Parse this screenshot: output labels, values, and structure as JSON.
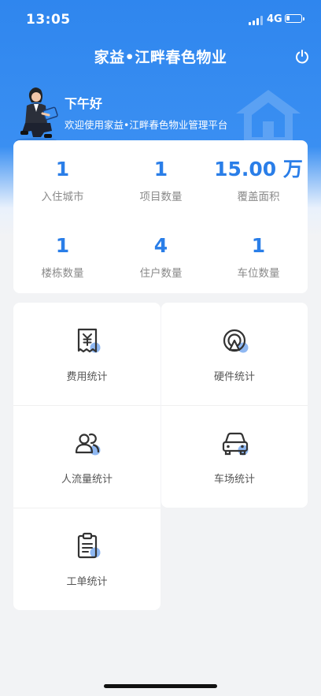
{
  "status_bar": {
    "time": "13:05",
    "network": "4G"
  },
  "nav": {
    "title": "家益•江畔春色物业",
    "power_icon": "power-icon"
  },
  "greeting": {
    "title": "下午好",
    "subtitle": "欢迎使用家益•江畔春色物业管理平台"
  },
  "stats": [
    {
      "value": "1",
      "label": "入住城市"
    },
    {
      "value": "1",
      "label": "项目数量"
    },
    {
      "value": "15.00 万",
      "label": "覆盖面积"
    },
    {
      "value": "1",
      "label": "楼栋数量"
    },
    {
      "value": "4",
      "label": "住户数量"
    },
    {
      "value": "1",
      "label": "车位数量"
    }
  ],
  "menu": [
    {
      "label": "费用统计",
      "icon": "receipt-icon"
    },
    {
      "label": "硬件统计",
      "icon": "hardware-icon"
    },
    {
      "label": "人流量统计",
      "icon": "people-icon"
    },
    {
      "label": "车场统计",
      "icon": "car-icon"
    },
    {
      "label": "工单统计",
      "icon": "clipboard-icon"
    }
  ],
  "colors": {
    "primary": "#2f86ee",
    "accent_dot": "#8fb8f2",
    "stat_value": "#2a7ee8"
  }
}
